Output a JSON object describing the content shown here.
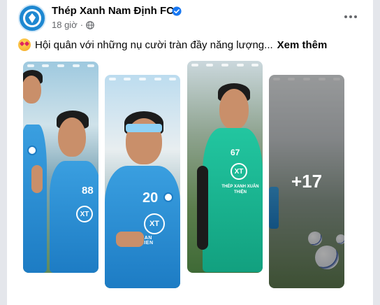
{
  "post": {
    "page_name": "Thép Xanh Nam Định FC",
    "time": "18 giờ",
    "audience_icon": "globe-icon",
    "verified_icon": "verified-badge-icon",
    "more_icon": "more-options-icon",
    "caption_emoji": "star-struck-emoji",
    "caption": "Hội quân với những nụ cười tràn đầy năng lượng...",
    "see_more": "Xem thêm"
  },
  "gallery": {
    "more_count_label": "+17",
    "photos": [
      {
        "jersey_number": "88"
      },
      {
        "jersey_number": "20",
        "sponsor_text": "XUAN THIEN"
      },
      {
        "jersey_number": "67",
        "sponsor_text": "THÉP XANH XUÂN THIỆN"
      },
      {}
    ]
  },
  "colors": {
    "brand_blue": "#1d7cc4",
    "text_primary": "#050505",
    "text_secondary": "#65676b",
    "verified_blue": "#1877f2"
  }
}
